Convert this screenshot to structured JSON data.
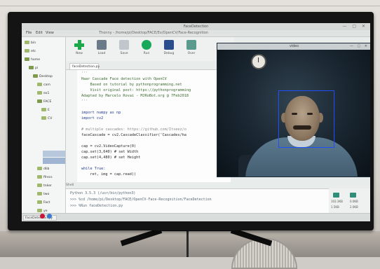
{
  "ide": {
    "title": "FaceDetection",
    "window_controls": "— ▢ ✕",
    "subtitle": "Thonny - /home/pi/Desktop/FACE/Ex/OpenCV/Face-Recognition",
    "menu": [
      "File",
      "Edit",
      "View"
    ],
    "toolbar": [
      {
        "label": "New",
        "icon": "plus-icon"
      },
      {
        "label": "Load",
        "icon": "load-icon"
      },
      {
        "label": "Save",
        "icon": "save-icon"
      },
      {
        "label": "Run",
        "icon": "run-icon"
      },
      {
        "label": "Debug",
        "icon": "debug-icon"
      },
      {
        "label": "Over",
        "icon": "over-icon"
      }
    ],
    "file_tree": [
      "bin",
      "etc",
      "home",
      "pi",
      "Desktop",
      "cam",
      "ex1",
      "FACE",
      "E",
      "CV",
      "",
      "dlib",
      "ffrecs",
      "tnker",
      "two",
      "Fact",
      "ye"
    ],
    "editor_tab": "faceDetection.py",
    "code": [
      {
        "text": "'''",
        "style": "comment"
      },
      {
        "text": "Haar Cascade Face detection with OpenCV",
        "style": "string"
      },
      {
        "text": "    Based on tutorial by pythonprogramming.net",
        "style": "string"
      },
      {
        "text": "    Visit original post: https://pythonprogramming",
        "style": "string"
      },
      {
        "text": "Adapted by Marcelo Rovai - MJRoBot.org @ 7Feb2018",
        "style": "string"
      },
      {
        "text": "'''",
        "style": "comment"
      },
      {
        "text": "",
        "style": ""
      },
      {
        "text": "import numpy as np",
        "style": "kw"
      },
      {
        "text": "import cv2",
        "style": "kw"
      },
      {
        "text": "",
        "style": ""
      },
      {
        "text": "# multiple cascades: https://github.com/Itseez/o",
        "style": "comment"
      },
      {
        "text": "faceCascade = cv2.CascadeClassifier('Cascades/ha",
        "style": ""
      },
      {
        "text": "",
        "style": ""
      },
      {
        "text": "cap = cv2.VideoCapture(0)",
        "style": ""
      },
      {
        "text": "cap.set(3,640) # set Width",
        "style": ""
      },
      {
        "text": "cap.set(4,480) # set Height",
        "style": ""
      },
      {
        "text": "",
        "style": ""
      },
      {
        "text": "while True:",
        "style": "kw"
      },
      {
        "text": "    ret, img = cap.read()",
        "style": ""
      }
    ],
    "shell_label": "Shell",
    "shell": [
      "Python 3.5.3 (/usr/bin/python3)",
      ">>> %cd /home/pi/Desktop/FACE/OpenCV-Face-Recognition/FaceDetection",
      ">>> %Run faceDetection.py"
    ],
    "taskbar_item": "FaceDetection.py",
    "tray": [
      "102.3KB",
      "0.0KB",
      "1.5KB",
      "2.0KB"
    ]
  },
  "camera_window": {
    "title": "video",
    "window_controls": "— ▢ ✕"
  },
  "colors": {
    "face_box": "#1f4fff",
    "run_green": "#18a859"
  }
}
